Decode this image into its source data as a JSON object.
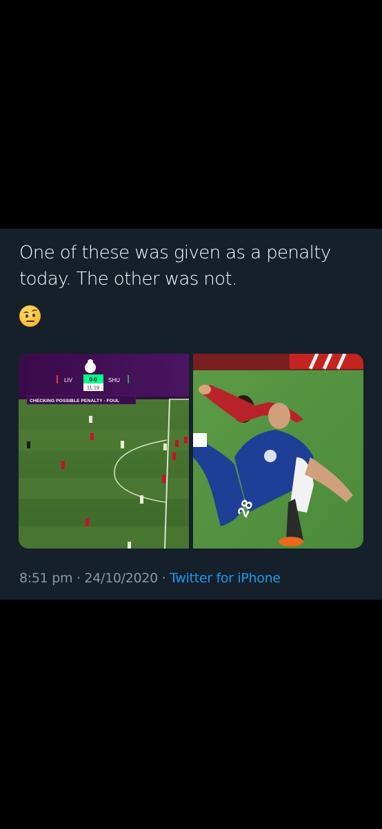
{
  "tweet": {
    "text_line1": "One of these was given as a penalty",
    "text_line2": "today. The other was not.",
    "emoji_name": "face-with-raised-eyebrow"
  },
  "scoreboard": {
    "home": "LIV",
    "score": "0-0",
    "away": "SHU",
    "clock": "11:19",
    "banner": "CHECKING POSSIBLE PENALTY - FOUL"
  },
  "jersey_number": "28",
  "meta": {
    "time": "8:51 pm",
    "sep1": " · ",
    "date": "24/10/2020",
    "sep2": " · ",
    "source": "Twitter for iPhone"
  },
  "colors": {
    "background": "#000000",
    "tweet_bg": "#15202b",
    "text": "#ffffff",
    "muted": "#8899a6",
    "link": "#1d9bf0"
  }
}
